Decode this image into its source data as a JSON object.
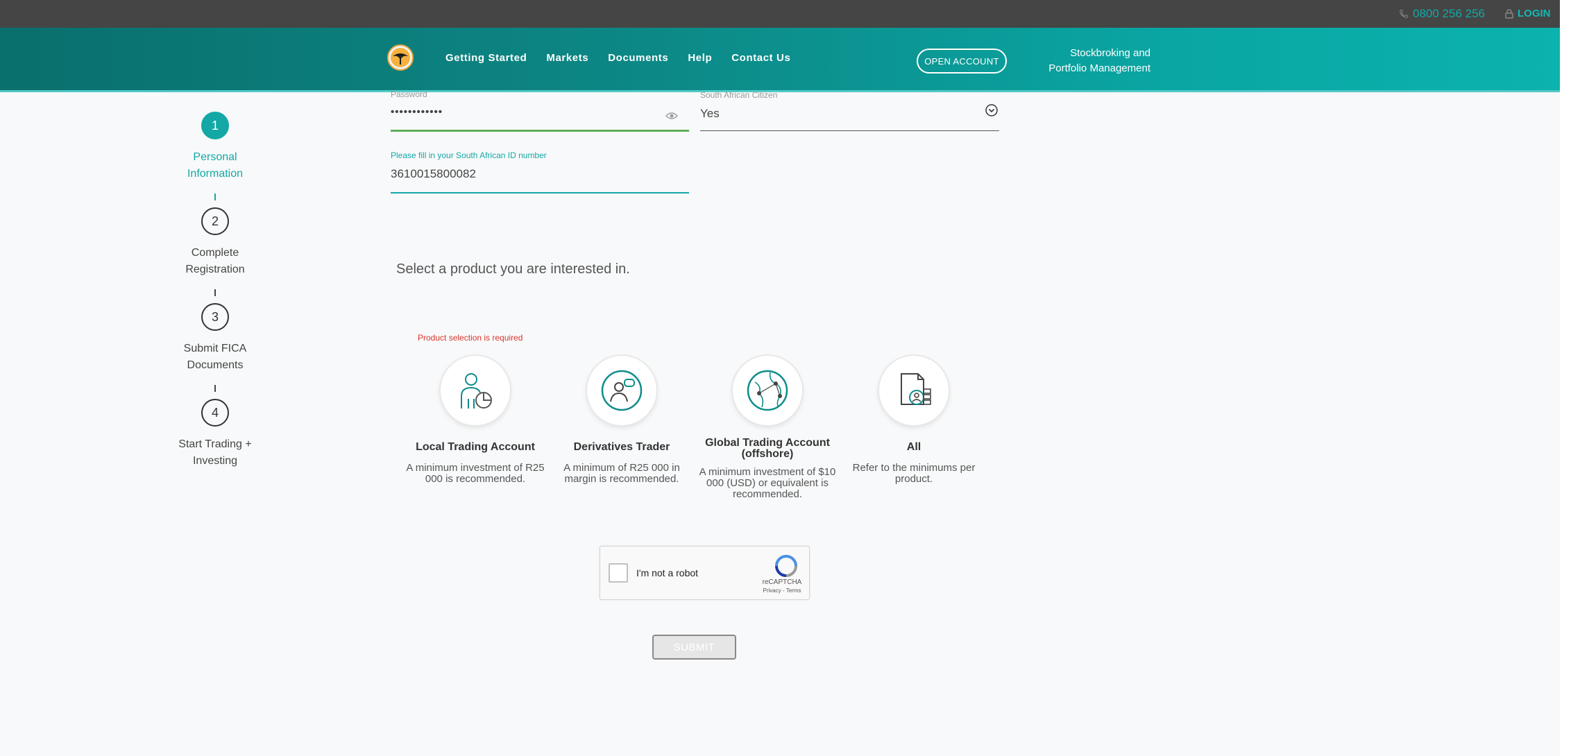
{
  "topbar": {
    "phone": "0800 256 256",
    "login": "LOGIN"
  },
  "header": {
    "nav": [
      "Getting Started",
      "Markets",
      "Documents",
      "Help",
      "Contact Us"
    ],
    "open_account": "OPEN ACCOUNT",
    "tagline_line1": "Stockbroking and",
    "tagline_line2": "Portfolio Management"
  },
  "steps": [
    {
      "number": "1",
      "line1": "Personal",
      "line2": "Information"
    },
    {
      "number": "2",
      "line1": "Complete",
      "line2": "Registration"
    },
    {
      "number": "3",
      "line1": "Submit FICA",
      "line2": "Documents"
    },
    {
      "number": "4",
      "line1": "Start Trading +",
      "line2": "Investing"
    }
  ],
  "form": {
    "password_label": "Password",
    "password_value": "••••••••••••",
    "citizen_label": "South African Citizen",
    "citizen_value": "Yes",
    "id_label": "Please fill in your South African ID number",
    "id_value": "3610015800082"
  },
  "products_title": "Select a product you are interested in.",
  "product_error": "Product selection is required",
  "products": [
    {
      "name": "Local Trading Account",
      "desc": "A minimum investment of R25 000 is recommended."
    },
    {
      "name": "Derivatives Trader",
      "desc": "A minimum of R25 000 in margin is recommended."
    },
    {
      "name": "Global Trading Account (offshore)",
      "desc": "A minimum investment of $10 000 (USD) or equivalent is recommended."
    },
    {
      "name": "All",
      "desc": "Refer to the minimums per product."
    }
  ],
  "captcha": {
    "label": "I'm not a robot",
    "brand": "reCAPTCHA",
    "terms": "Privacy - Terms"
  },
  "submit": "SUBMIT",
  "colors": {
    "accent": "#13a8a6",
    "error": "#d9362b",
    "header_dark": "#0a6f6d"
  }
}
